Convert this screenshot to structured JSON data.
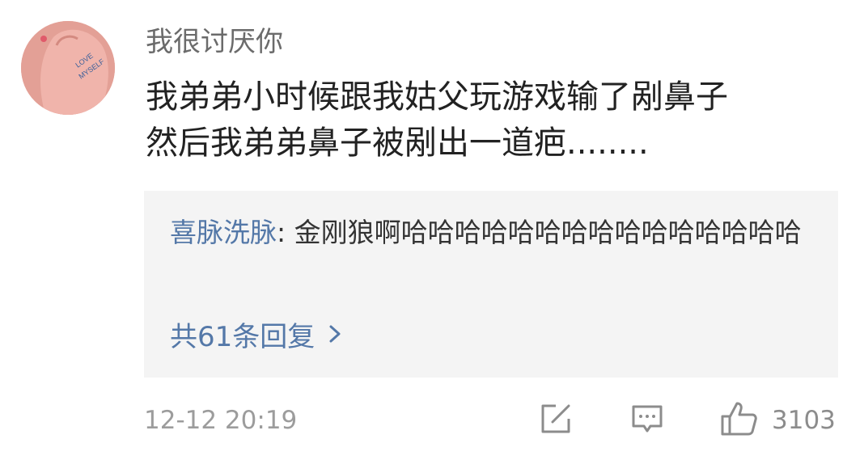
{
  "user": {
    "name": "我很讨厌你",
    "avatar_text": [
      "LOVE",
      "MYSELF"
    ]
  },
  "comment": {
    "line1": "我弟弟小时候跟我姑父玩游戏输了剐鼻子",
    "line2": "然后我弟弟鼻子被剐出一道疤........"
  },
  "reply": {
    "author": "喜脉洗脉",
    "separator": ": ",
    "text": "金刚狼啊哈哈哈哈哈哈哈哈哈哈哈哈哈哈哈",
    "count_label": "共61条回复",
    "chevron_icon": "chevron-right-icon"
  },
  "footer": {
    "timestamp": "12-12 20:19",
    "like_count": "3103",
    "icons": [
      "edit-icon",
      "comment-icon",
      "thumbs-up-icon"
    ]
  },
  "colors": {
    "link": "#5478a8",
    "reply_bg": "#f4f4f4",
    "meta": "#9c9c9c"
  }
}
